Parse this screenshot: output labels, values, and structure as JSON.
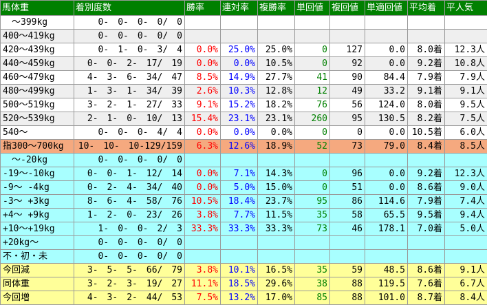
{
  "headers": [
    "馬体重",
    "着別度数",
    "勝率",
    "連対率",
    "複勝率",
    "単回値",
    "複回値",
    "単適回値",
    "平均着",
    "平人気"
  ],
  "colors": {
    "header_bg": "#008000",
    "header_text": "#ffffff",
    "odd_row": "#ffffff",
    "even_row": "#efefef",
    "highlight_row": "#f5a97f",
    "change_rows": "#a8ffff",
    "summary_rows": "#ffff99",
    "win_rate_text": "#ff0000",
    "rentai_text": "#0000ff",
    "tan_kaishu_text": "#008000"
  },
  "rows": [
    {
      "label": "　～399kg",
      "record": "0-　0-　0-　0/　0",
      "win": "",
      "rentai": "",
      "fukusho": "",
      "tan": "",
      "fuku": "",
      "tanteki": "",
      "avg_rank": "",
      "avg_pop": "",
      "group": "g0"
    },
    {
      "label": "400～419kg",
      "record": "0-　0-　0-　0/　0",
      "win": "",
      "rentai": "",
      "fukusho": "",
      "tan": "",
      "fuku": "",
      "tanteki": "",
      "avg_rank": "",
      "avg_pop": "",
      "group": "g1"
    },
    {
      "label": "420～439kg",
      "record": "0-　1-　0-　3/　4",
      "win": "0.0%",
      "rentai": "25.0%",
      "fukusho": "25.0%",
      "tan": "0",
      "fuku": "127",
      "tanteki": "0.0",
      "avg_rank": "8.0着",
      "avg_pop": "12.3人",
      "group": "g0"
    },
    {
      "label": "440～459kg",
      "record": "0-　0-　2-　17/　19",
      "win": "0.0%",
      "rentai": "0.0%",
      "fukusho": "10.5%",
      "tan": "0",
      "fuku": "92",
      "tanteki": "0.0",
      "avg_rank": "9.2着",
      "avg_pop": "10.8人",
      "group": "g1"
    },
    {
      "label": "460～479kg",
      "record": "4-　3-　6-　34/　47",
      "win": "8.5%",
      "rentai": "14.9%",
      "fukusho": "27.7%",
      "tan": "41",
      "fuku": "90",
      "tanteki": "84.4",
      "avg_rank": "7.9着",
      "avg_pop": "7.9人",
      "group": "g0"
    },
    {
      "label": "480～499kg",
      "record": "1-　3-　1-　34/　39",
      "win": "2.6%",
      "rentai": "10.3%",
      "fukusho": "12.8%",
      "tan": "12",
      "fuku": "49",
      "tanteki": "33.2",
      "avg_rank": "9.1着",
      "avg_pop": "9.1人",
      "group": "g1"
    },
    {
      "label": "500～519kg",
      "record": "3-　2-　1-　27/　33",
      "win": "9.1%",
      "rentai": "15.2%",
      "fukusho": "18.2%",
      "tan": "76",
      "fuku": "56",
      "tanteki": "124.0",
      "avg_rank": "8.0着",
      "avg_pop": "9.5人",
      "group": "g0"
    },
    {
      "label": "520～539kg",
      "record": "2-　1-　0-　10/　13",
      "win": "15.4%",
      "rentai": "23.1%",
      "fukusho": "23.1%",
      "tan": "260",
      "fuku": "95",
      "tanteki": "130.5",
      "avg_rank": "8.2着",
      "avg_pop": "7.5人",
      "group": "g1"
    },
    {
      "label": "540～",
      "record": "0-　0-　0-　4/　4",
      "win": "0.0%",
      "rentai": "0.0%",
      "fukusho": "0.0%",
      "tan": "0",
      "fuku": "0",
      "tanteki": "0.0",
      "avg_rank": "10.5着",
      "avg_pop": "6.0人",
      "group": "g0"
    },
    {
      "label": "指300～700kg",
      "record": "10-　10-　10-129/159",
      "win": "6.3%",
      "rentai": "12.6%",
      "fukusho": "18.9%",
      "tan": "52",
      "fuku": "73",
      "tanteki": "79.0",
      "avg_rank": "8.4着",
      "avg_pop": "8.5人",
      "group": "ghl"
    },
    {
      "label": "　～-20kg",
      "record": "0-　0-　0-　0/　0",
      "win": "",
      "rentai": "",
      "fukusho": "",
      "tan": "",
      "fuku": "",
      "tanteki": "",
      "avg_rank": "",
      "avg_pop": "",
      "group": "gcy"
    },
    {
      "label": "-19～-10kg",
      "record": "0-　0-　1-　12/　14",
      "win": "0.0%",
      "rentai": "7.1%",
      "fukusho": "14.3%",
      "tan": "0",
      "fuku": "96",
      "tanteki": "0.0",
      "avg_rank": "9.2着",
      "avg_pop": "12.3人",
      "group": "gcy"
    },
    {
      "label": "-9～ -4kg",
      "record": "0-　2-　4-　34/　40",
      "win": "0.0%",
      "rentai": "5.0%",
      "fukusho": "15.0%",
      "tan": "0",
      "fuku": "51",
      "tanteki": "0.0",
      "avg_rank": "8.6着",
      "avg_pop": "9.0人",
      "group": "gcy"
    },
    {
      "label": "-3～ +3kg",
      "record": "8-　6-　4-　58/　76",
      "win": "10.5%",
      "rentai": "18.4%",
      "fukusho": "23.7%",
      "tan": "95",
      "fuku": "86",
      "tanteki": "114.6",
      "avg_rank": "7.9着",
      "avg_pop": "7.4人",
      "group": "gcy"
    },
    {
      "label": "+4～ +9kg",
      "record": "1-　2-　0-　23/　26",
      "win": "3.8%",
      "rentai": "7.7%",
      "fukusho": "11.5%",
      "tan": "35",
      "fuku": "58",
      "tanteki": "65.5",
      "avg_rank": "9.5着",
      "avg_pop": "9.4人",
      "group": "gcy"
    },
    {
      "label": "+10～+19kg",
      "record": "1-　0-　0-　2/　3",
      "win": "33.3%",
      "rentai": "33.3%",
      "fukusho": "33.3%",
      "tan": "73",
      "fuku": "46",
      "tanteki": "178.1",
      "avg_rank": "7.0着",
      "avg_pop": "5.0人",
      "group": "gcy"
    },
    {
      "label": "+20kg～",
      "record": "0-　0-　0-　0/　0",
      "win": "",
      "rentai": "",
      "fukusho": "",
      "tan": "",
      "fuku": "",
      "tanteki": "",
      "avg_rank": "",
      "avg_pop": "",
      "group": "gcy"
    },
    {
      "label": "不・初・未",
      "record": "0-　0-　0-　0/　0",
      "win": "",
      "rentai": "",
      "fukusho": "",
      "tan": "",
      "fuku": "",
      "tanteki": "",
      "avg_rank": "",
      "avg_pop": "",
      "group": "gcy"
    },
    {
      "label": "今回減",
      "record": "3-　5-　5-　66/　79",
      "win": "3.8%",
      "rentai": "10.1%",
      "fukusho": "16.5%",
      "tan": "35",
      "fuku": "59",
      "tanteki": "48.5",
      "avg_rank": "8.6着",
      "avg_pop": "9.1人",
      "group": "gyl"
    },
    {
      "label": "同体重",
      "record": "3-　2-　3-　19/　27",
      "win": "11.1%",
      "rentai": "18.5%",
      "fukusho": "29.6%",
      "tan": "38",
      "fuku": "88",
      "tanteki": "119.5",
      "avg_rank": "7.6着",
      "avg_pop": "6.7人",
      "group": "gyl"
    },
    {
      "label": "今回増",
      "record": "4-　3-　2-　44/　53",
      "win": "7.5%",
      "rentai": "13.2%",
      "fukusho": "17.0%",
      "tan": "85",
      "fuku": "88",
      "tanteki": "101.0",
      "avg_rank": "8.7着",
      "avg_pop": "8.4人",
      "group": "gyl"
    }
  ]
}
